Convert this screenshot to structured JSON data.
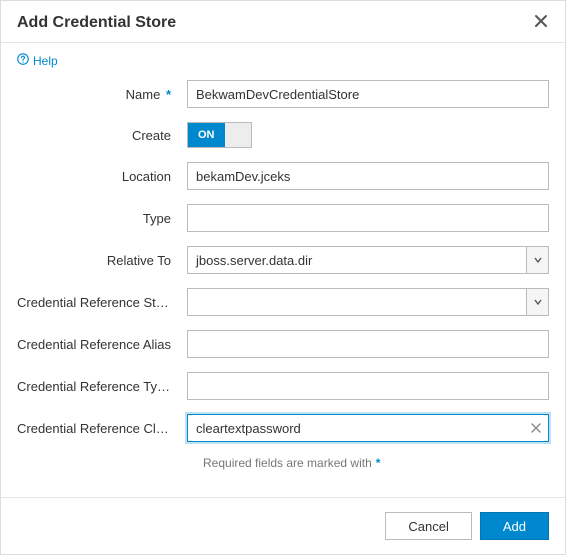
{
  "header": {
    "title": "Add Credential Store"
  },
  "help": {
    "label": "Help"
  },
  "form": {
    "name": {
      "label": "Name",
      "value": "BekwamDevCredentialStore",
      "required": true
    },
    "create": {
      "label": "Create",
      "on_text": "ON"
    },
    "location": {
      "label": "Location",
      "value": "bekamDev.jceks"
    },
    "type": {
      "label": "Type",
      "value": ""
    },
    "relative_to": {
      "label": "Relative To",
      "value": "jboss.server.data.dir"
    },
    "cred_ref_store": {
      "label": "Credential Reference Store",
      "value": ""
    },
    "cred_ref_alias": {
      "label": "Credential Reference Alias",
      "value": ""
    },
    "cred_ref_type": {
      "label": "Credential Reference Type",
      "value": ""
    },
    "cred_ref_clear": {
      "label": "Credential Reference Clea…",
      "value": "cleartextpassword"
    },
    "required_note": "Required fields are marked with"
  },
  "footer": {
    "cancel": "Cancel",
    "add": "Add"
  }
}
